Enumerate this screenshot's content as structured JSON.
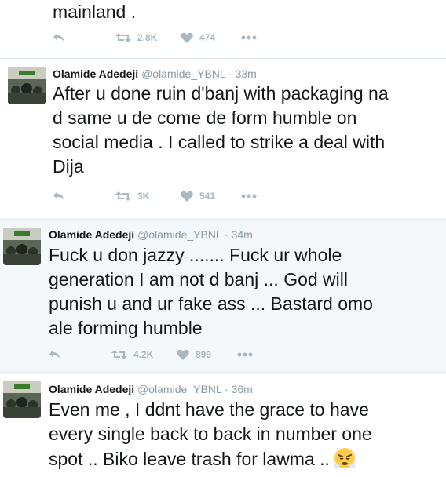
{
  "tweets": [
    {
      "partial": true,
      "text_lines": [
        "mainland ."
      ],
      "retweets": "2.8K",
      "likes": "474"
    },
    {
      "name": "Olamide Adedeji",
      "handle": "@olamide_YBNL",
      "separator": "·",
      "time": "33m",
      "text_lines": [
        "After u done ruin d'banj with packaging na",
        "d same u de come de form humble on",
        "social media . I called to strike a deal with",
        "Dija"
      ],
      "retweets": "3K",
      "likes": "541"
    },
    {
      "name": "Olamide Adedeji",
      "handle": "@olamide_YBNL",
      "separator": "·",
      "time": "34m",
      "text_lines": [
        "Fuck u don jazzy ....... Fuck ur whole",
        "generation I am not d banj ... God will",
        "punish u and ur fake ass ... Bastard omo",
        "ale forming humble"
      ],
      "retweets": "4.2K",
      "likes": "899"
    },
    {
      "name": "Olamide Adedeji",
      "handle": "@olamide_YBNL",
      "separator": "·",
      "time": "36m",
      "text_lines": [
        "Even me , I ddnt have the grace to have",
        "every single back to back in number one",
        "spot .. Biko leave trash for lawma .."
      ],
      "emoji_icon": "face-with-steam-from-nose-emoji"
    }
  ],
  "colors": {
    "text": "#14171a",
    "muted": "#8899a6",
    "action": "#aab8c2",
    "highlight_bg": "#f5f8fa",
    "divider": "#e1e8ed"
  }
}
